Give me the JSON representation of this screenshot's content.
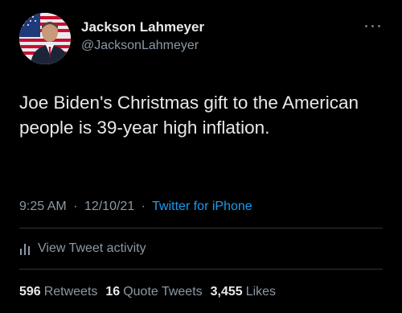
{
  "author": {
    "display_name": "Jackson Lahmeyer",
    "handle": "@JacksonLahmeyer",
    "avatar_icon": "profile-photo-with-flag"
  },
  "tweet": {
    "text": "Joe Biden's Christmas gift to the American people is 39-year high inflation."
  },
  "meta": {
    "time": "9:25 AM",
    "separator": "·",
    "date": "12/10/21",
    "source": "Twitter for iPhone"
  },
  "activity": {
    "label": "View Tweet activity",
    "icon": "bar-chart-icon"
  },
  "stats": {
    "retweets_count": "596",
    "retweets_label": "Retweets",
    "quotes_count": "16",
    "quotes_label": "Quote Tweets",
    "likes_count": "3,455",
    "likes_label": "Likes"
  },
  "colors": {
    "background": "#000000",
    "primary_text": "#e7e9ea",
    "secondary_text": "#8b98a5",
    "link": "#1d9bf0",
    "divider": "#2f3336"
  }
}
